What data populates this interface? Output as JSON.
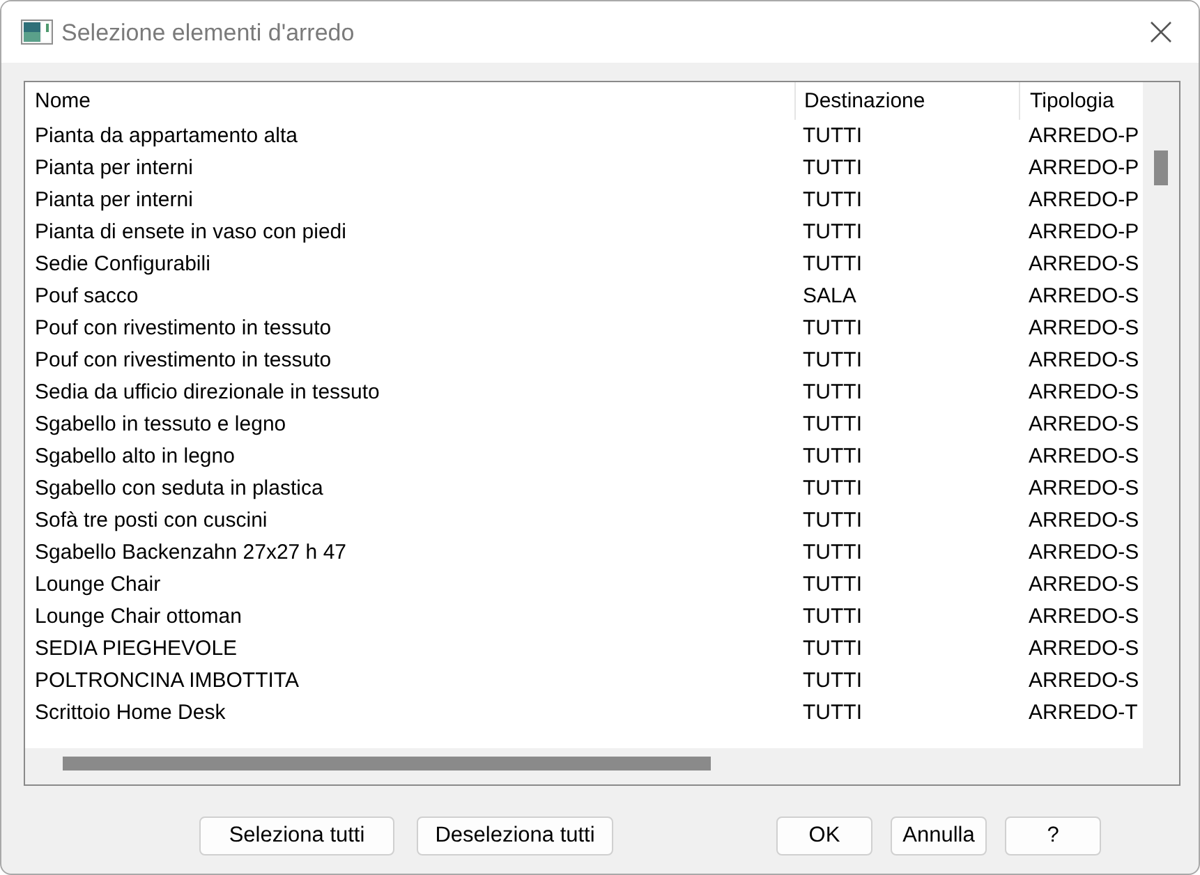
{
  "window": {
    "title": "Selezione elementi d'arredo"
  },
  "table": {
    "columns": [
      "Nome",
      "Destinazione",
      "Tipologia"
    ],
    "rows": [
      [
        "Pianta da appartamento alta",
        "TUTTI",
        "ARREDO-P"
      ],
      [
        "Pianta per interni",
        "TUTTI",
        "ARREDO-P"
      ],
      [
        "Pianta per interni",
        "TUTTI",
        "ARREDO-P"
      ],
      [
        "Pianta di ensete in vaso con piedi",
        "TUTTI",
        "ARREDO-P"
      ],
      [
        "Sedie Configurabili",
        "TUTTI",
        "ARREDO-S"
      ],
      [
        "Pouf sacco",
        "SALA",
        "ARREDO-S"
      ],
      [
        "Pouf con rivestimento in tessuto",
        "TUTTI",
        "ARREDO-S"
      ],
      [
        "Pouf con rivestimento in tessuto",
        "TUTTI",
        "ARREDO-S"
      ],
      [
        "Sedia da ufficio direzionale in tessuto",
        "TUTTI",
        "ARREDO-S"
      ],
      [
        "Sgabello in tessuto e legno",
        "TUTTI",
        "ARREDO-S"
      ],
      [
        "Sgabello alto in legno",
        "TUTTI",
        "ARREDO-S"
      ],
      [
        "Sgabello con seduta in plastica",
        "TUTTI",
        "ARREDO-S"
      ],
      [
        "Sofà tre posti con cuscini",
        "TUTTI",
        "ARREDO-S"
      ],
      [
        "Sgabello Backenzahn 27x27 h 47",
        "TUTTI",
        "ARREDO-S"
      ],
      [
        "Lounge Chair",
        "TUTTI",
        "ARREDO-S"
      ],
      [
        "Lounge Chair ottoman",
        "TUTTI",
        "ARREDO-S"
      ],
      [
        "SEDIA PIEGHEVOLE",
        "TUTTI",
        "ARREDO-S"
      ],
      [
        "POLTRONCINA IMBOTTITA",
        "TUTTI",
        "ARREDO-S"
      ],
      [
        "Scrittoio Home Desk",
        "TUTTI",
        "ARREDO-T"
      ]
    ]
  },
  "selection_buttons": [
    {
      "label": "Seleziona tutti"
    },
    {
      "label": "Deseleziona tutti"
    }
  ],
  "dialog_buttons": [
    {
      "label": "OK"
    },
    {
      "label": "Annulla"
    },
    {
      "label": "?"
    }
  ]
}
